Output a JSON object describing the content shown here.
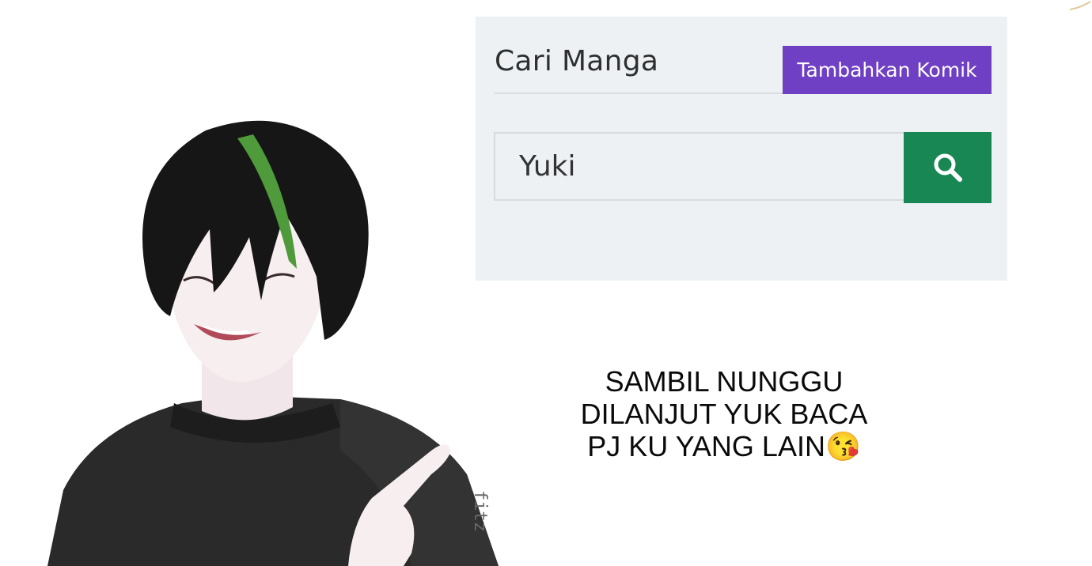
{
  "search_panel": {
    "title": "Cari Manga",
    "add_button_label": "Tambahkan Komik",
    "search_value": "Yuki",
    "search_icon": "search-icon"
  },
  "caption": {
    "lines": [
      "SAMBIL NUNGGU",
      "DILANJUT YUK BACA",
      "PJ KU YANG LAIN😘"
    ]
  },
  "colors": {
    "accent_purple": "#6f3fc4",
    "search_green": "#198754",
    "panel_bg": "#edf1f4"
  }
}
